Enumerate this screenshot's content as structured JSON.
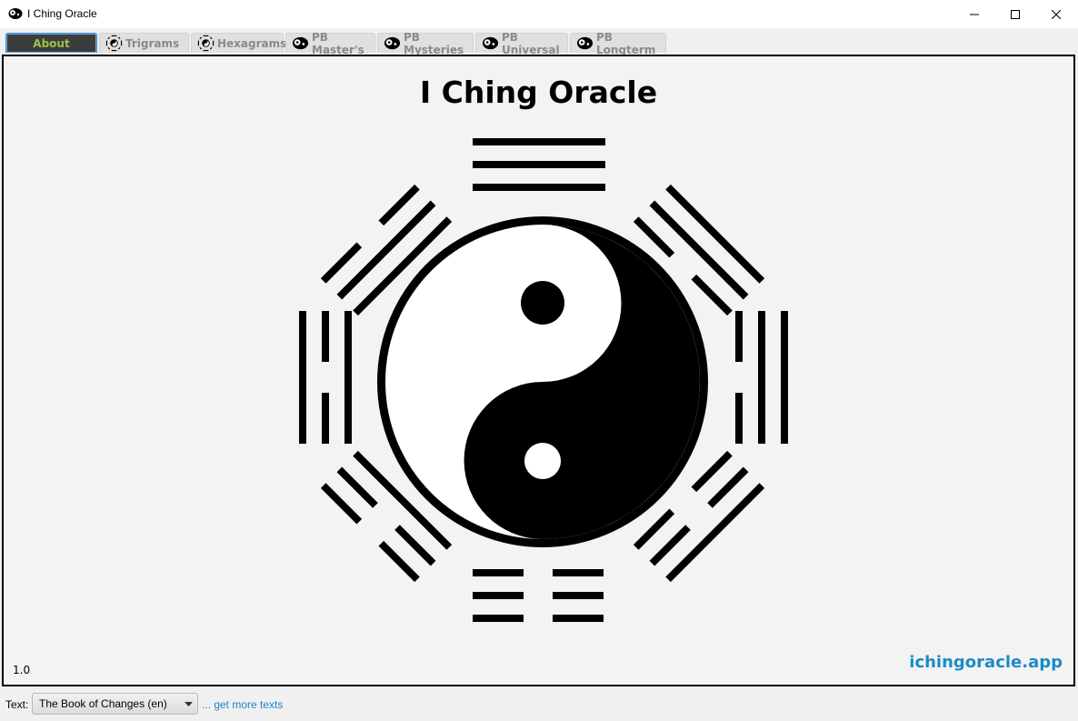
{
  "window": {
    "title": "I Ching Oracle",
    "icon": "yin-yang-icon"
  },
  "tabs": [
    {
      "label": "About",
      "icon": "",
      "active": true
    },
    {
      "label": "Trigrams",
      "icon": "bagua-icon",
      "active": false
    },
    {
      "label": "Hexagrams",
      "icon": "bagua-icon",
      "active": false
    },
    {
      "label": "PB Master's",
      "icon": "yin-yang-icon",
      "active": false
    },
    {
      "label": "PB Mysteries",
      "icon": "yin-yang-icon",
      "active": false
    },
    {
      "label": "PB Universal",
      "icon": "yin-yang-icon",
      "active": false
    },
    {
      "label": "PB Longterm",
      "icon": "yin-yang-icon",
      "active": false
    }
  ],
  "about": {
    "title": "I Ching Oracle",
    "version": "1.0",
    "website": "ichingoracle.app"
  },
  "footer": {
    "text_label": "Text:",
    "selected_text": "The Book of Changes (en)",
    "more_link": "... get more texts"
  },
  "colors": {
    "active_tab_bg": "#3c3c3c",
    "active_tab_text": "#9bc53d",
    "link": "#1a8cc4"
  }
}
